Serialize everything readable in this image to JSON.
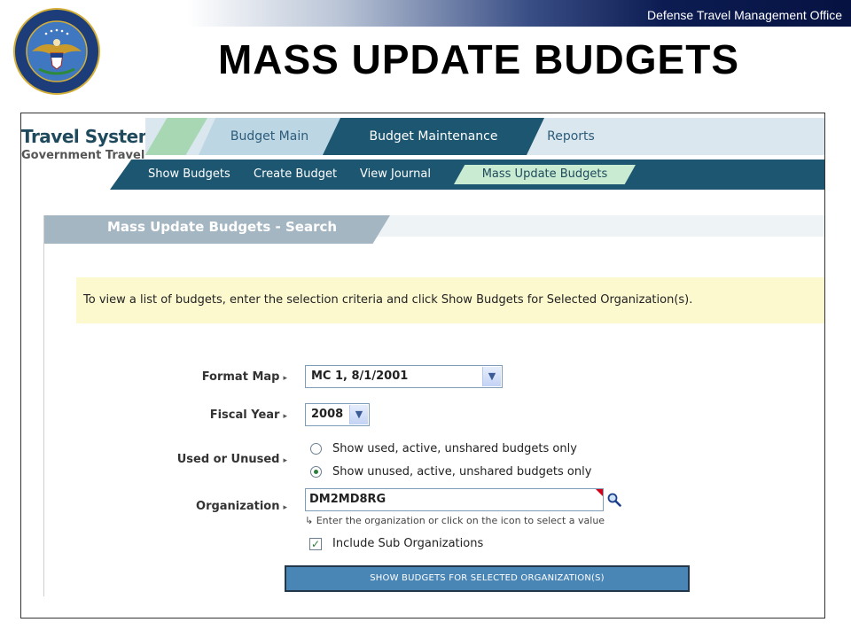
{
  "header": {
    "office": "Defense Travel Management Office",
    "title": "MASS UPDATE BUDGETS"
  },
  "app": {
    "brand_line1": "Travel System",
    "brand_line2": "Government Travel",
    "tabs": [
      {
        "label": "Budget Main"
      },
      {
        "label": "Budget Maintenance"
      },
      {
        "label": "Reports"
      }
    ],
    "subnav": [
      {
        "label": "Show Budgets"
      },
      {
        "label": "Create Budget"
      },
      {
        "label": "View Journal"
      },
      {
        "label": "Mass Update Budgets"
      }
    ]
  },
  "panel": {
    "title": "Mass Update Budgets - Search",
    "info": "To view a list of budgets, enter the selection criteria and click Show Budgets for Selected Organization(s)."
  },
  "form": {
    "format_map_label": "Format Map",
    "format_map_value": "MC 1, 8/1/2001",
    "fiscal_year_label": "Fiscal Year",
    "fiscal_year_value": "2008",
    "used_label": "Used or Unused",
    "used_options": [
      {
        "label": "Show used, active, unshared budgets only",
        "selected": false
      },
      {
        "label": "Show unused, active, unshared budgets only",
        "selected": true
      }
    ],
    "organization_label": "Organization",
    "organization_value": "DM2MD8RG",
    "organization_hint": "Enter the organization or click on the icon to select a value",
    "include_sub_label": "Include Sub Organizations",
    "include_sub_checked": true,
    "submit_label": "SHOW BUDGETS FOR SELECTED ORGANIZATION(S)"
  },
  "icons": {
    "seal": "dod-seal-icon",
    "dropdown": "chevron-down-icon",
    "lookup": "magnifier-icon",
    "checkmark": "checkmark-icon"
  },
  "colors": {
    "nav_dark": "#1d5670",
    "nav_light": "#bcd6e3",
    "active_sub": "#c9ebd1",
    "info_bg": "#fdf9cf",
    "button": "#4a86b5"
  }
}
